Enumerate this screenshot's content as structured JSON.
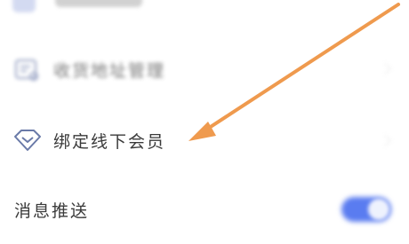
{
  "settings": {
    "top_item": {
      "label": "",
      "icon": "blurred-settings-icon"
    },
    "address_item": {
      "label": "收货地址管理",
      "icon": "address-card-icon"
    },
    "membership_item": {
      "label": "绑定线下会员",
      "icon": "diamond-icon"
    },
    "push_item": {
      "label": "消息推送",
      "toggle_on": true
    }
  },
  "colors": {
    "accent_toggle": "#5a7cf0",
    "annotation_arrow": "#ef9a4e",
    "text": "#3a3a3a",
    "icon": "#6a7aa8"
  }
}
